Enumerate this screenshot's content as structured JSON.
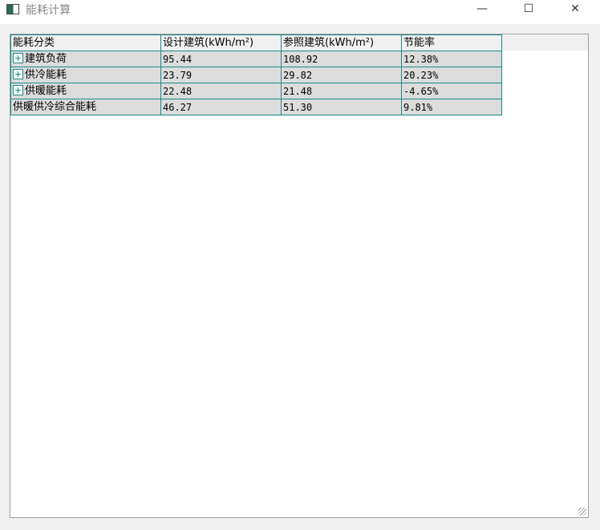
{
  "window": {
    "title": "能耗计算",
    "minimize": "—",
    "maximize": "☐",
    "close": "✕"
  },
  "table": {
    "headers": [
      "能耗分类",
      "设计建筑(kWh/m²)",
      "参照建筑(kWh/m²)",
      "节能率"
    ],
    "rows": [
      {
        "expandable": true,
        "cells": [
          "建筑负荷",
          "95.44",
          "108.92",
          "12.38%"
        ]
      },
      {
        "expandable": true,
        "cells": [
          "供冷能耗",
          "23.79",
          "29.82",
          "20.23%"
        ]
      },
      {
        "expandable": true,
        "cells": [
          "供暖能耗",
          "22.48",
          "21.48",
          "-4.65%"
        ]
      },
      {
        "expandable": false,
        "cells": [
          "供暖供冷综合能耗",
          "46.27",
          "51.30",
          "9.81%"
        ]
      }
    ]
  }
}
